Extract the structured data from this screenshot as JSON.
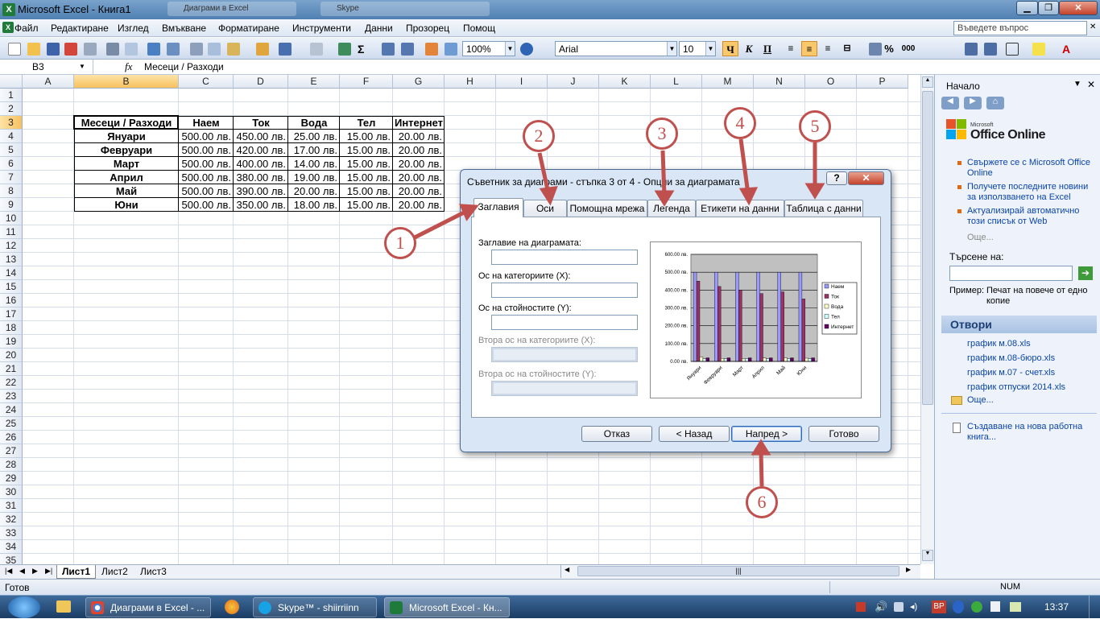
{
  "window": {
    "title": "Microsoft Excel - Книга1",
    "ghost_tab_1": "Диаграми в Excel",
    "ghost_tab_2": "Skype"
  },
  "menubar": {
    "items": [
      "Файл",
      "Редактиране",
      "Изглед",
      "Вмъкване",
      "Форматиране",
      "Инструменти",
      "Данни",
      "Прозорец",
      "Помощ"
    ],
    "ask_placeholder": "Въведете въпрос"
  },
  "toolbar": {
    "zoom": "100%",
    "font": "Arial",
    "size": "10",
    "bold": "Ч",
    "italic": "К",
    "underline": "П",
    "percent": "%",
    "thousands": "000"
  },
  "formula_bar": {
    "name_box": "B3",
    "fx": "fx",
    "formula": "Месеци / Разходи"
  },
  "sheet": {
    "columns": [
      "A",
      "B",
      "C",
      "D",
      "E",
      "F",
      "G",
      "H",
      "I",
      "J",
      "K",
      "L",
      "M",
      "N",
      "O",
      "P"
    ],
    "rows": [
      "1",
      "2",
      "3",
      "4",
      "5",
      "6",
      "7",
      "8",
      "9",
      "10",
      "11",
      "12",
      "13",
      "14",
      "15",
      "16",
      "17",
      "18",
      "19",
      "20",
      "21",
      "22",
      "23",
      "24",
      "25",
      "26",
      "27",
      "28",
      "29",
      "30",
      "31",
      "32",
      "33",
      "34",
      "35"
    ],
    "header": [
      "Месеци / Разходи",
      "Наем",
      "Ток",
      "Вода",
      "Тел",
      "Интернет"
    ],
    "data": [
      [
        "Януари",
        "500.00 лв.",
        "450.00 лв.",
        "25.00 лв.",
        "15.00 лв.",
        "20.00 лв."
      ],
      [
        "Февруари",
        "500.00 лв.",
        "420.00 лв.",
        "17.00 лв.",
        "15.00 лв.",
        "20.00 лв."
      ],
      [
        "Март",
        "500.00 лв.",
        "400.00 лв.",
        "14.00 лв.",
        "15.00 лв.",
        "20.00 лв."
      ],
      [
        "Април",
        "500.00 лв.",
        "380.00 лв.",
        "19.00 лв.",
        "15.00 лв.",
        "20.00 лв."
      ],
      [
        "Май",
        "500.00 лв.",
        "390.00 лв.",
        "20.00 лв.",
        "15.00 лв.",
        "20.00 лв."
      ],
      [
        "Юни",
        "500.00 лв.",
        "350.00 лв.",
        "18.00 лв.",
        "15.00 лв.",
        "20.00 лв."
      ]
    ],
    "tabs": [
      "Лист1",
      "Лист2",
      "Лист3"
    ]
  },
  "status": {
    "ready": "Готов",
    "num": "NUM"
  },
  "taskpane": {
    "title": "Начало",
    "office_small": "Microsoft",
    "office_big": "Office Online",
    "links": [
      "Свържете се с Microsoft Office Online",
      "Получете последните новини за използването на Excel",
      "Актуализирай автоматично този списък от Web"
    ],
    "more": "Още...",
    "search_label": "Търсене на:",
    "example_label": "Пример:",
    "example_text": "Печат на повече от едно копие",
    "open_title": "Отвори",
    "files": [
      "график м.08.xls",
      "график м.08-бюро.xls",
      "график м.07 - счет.xls",
      "график отпуски 2014.xls"
    ],
    "open_more": "Още...",
    "new_workbook": "Създаване на нова работна книга..."
  },
  "dialog": {
    "title": "Съветник за диаграми - стъпка 3 от 4 - Опции за диаграмата",
    "help": "?",
    "close": "✕",
    "tabs": [
      "Заглавия",
      "Оси",
      "Помощна мрежа",
      "Легенда",
      "Етикети на данни",
      "Таблица с данни"
    ],
    "fields": [
      {
        "label": "Заглавие на диаграмата:",
        "value": "",
        "enabled": true
      },
      {
        "label": "Ос на категориите (X):",
        "value": "",
        "enabled": true
      },
      {
        "label": "Ос на стойностите (Y):",
        "value": "",
        "enabled": true
      },
      {
        "label": "Втора ос на категориите (X):",
        "value": "",
        "enabled": false
      },
      {
        "label": "Втора ос на стойностите (Y):",
        "value": "",
        "enabled": false
      }
    ],
    "buttons": {
      "cancel": "Отказ",
      "back": "< Назад",
      "next": "Напред >",
      "finish": "Готово"
    }
  },
  "chart_data": {
    "type": "bar",
    "categories": [
      "Януари",
      "Февруари",
      "Март",
      "Април",
      "Май",
      "Юни"
    ],
    "series": [
      {
        "name": "Наем",
        "values": [
          500,
          500,
          500,
          500,
          500,
          500
        ],
        "color": "#9999ff"
      },
      {
        "name": "Ток",
        "values": [
          450,
          420,
          400,
          380,
          390,
          350
        ],
        "color": "#993366"
      },
      {
        "name": "Вода",
        "values": [
          25,
          17,
          14,
          19,
          20,
          18
        ],
        "color": "#ffffcc"
      },
      {
        "name": "Тел",
        "values": [
          15,
          15,
          15,
          15,
          15,
          15
        ],
        "color": "#ccffff"
      },
      {
        "name": "Интернет",
        "values": [
          20,
          20,
          20,
          20,
          20,
          20
        ],
        "color": "#660066"
      }
    ],
    "yticks": [
      "0.00 лв.",
      "100.00 лв.",
      "200.00 лв.",
      "300.00 лв.",
      "400.00 лв.",
      "500.00 лв.",
      "600.00 лв."
    ],
    "ylim": [
      0,
      600
    ],
    "legend": "right",
    "plot_bg": "#c0c0c0"
  },
  "annotations": {
    "markers": [
      "1",
      "2",
      "3",
      "4",
      "5",
      "6"
    ],
    "color": "#c0504d"
  },
  "taskbar": {
    "tasks": [
      "Диаграми в Excel - ...",
      "Skype™ - shiirriinn",
      "Microsoft Excel - Кн..."
    ],
    "lang": "BP",
    "clock": "13:37"
  }
}
